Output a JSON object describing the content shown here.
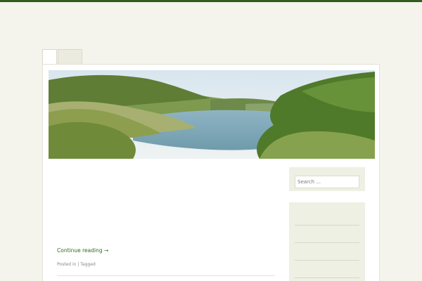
{
  "site": {
    "title": "",
    "description": ""
  },
  "nav": {
    "tabs": [
      {
        "label": ""
      },
      {
        "label": ""
      }
    ]
  },
  "post": {
    "date": "",
    "title": "",
    "paragraph1_highlight": "",
    "paragraph1_rest": "",
    "paragraph2": "",
    "paragraph3": "",
    "paragraph4": "",
    "read_more": "Continue reading →",
    "meta": {
      "posted_in_label": "Posted in",
      "categories": [
        "",
        ""
      ],
      "tagged_label": "Tagged",
      "tags": [
        "",
        "",
        "",
        "",
        "",
        "",
        ""
      ]
    }
  },
  "sidebar": {
    "search_placeholder": "Search ...",
    "links": [
      {
        "label": ""
      },
      {
        "label": ""
      },
      {
        "label": ""
      },
      {
        "label": ""
      }
    ]
  },
  "colors": {
    "accent": "#2f6b1f",
    "background": "#f4f4ec",
    "widget_bg": "#eef0e4"
  }
}
